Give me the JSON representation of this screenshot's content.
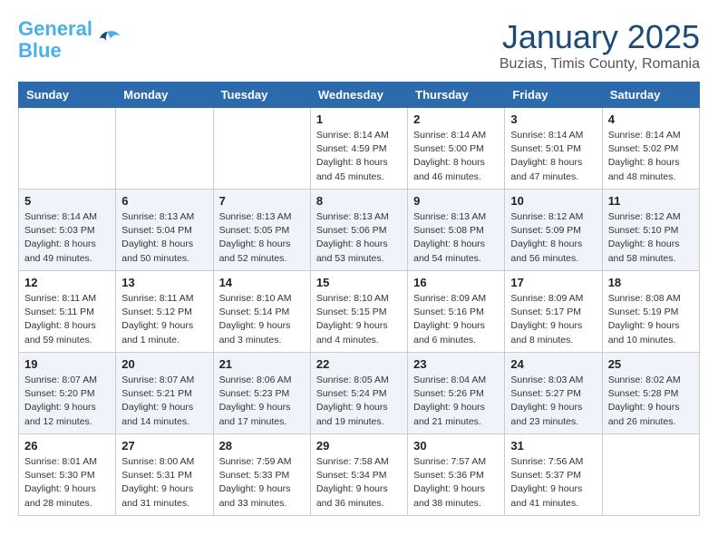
{
  "header": {
    "logo_line1": "General",
    "logo_line2": "Blue",
    "title": "January 2025",
    "subtitle": "Buzias, Timis County, Romania"
  },
  "weekdays": [
    "Sunday",
    "Monday",
    "Tuesday",
    "Wednesday",
    "Thursday",
    "Friday",
    "Saturday"
  ],
  "weeks": [
    [
      {
        "day": "",
        "info": ""
      },
      {
        "day": "",
        "info": ""
      },
      {
        "day": "",
        "info": ""
      },
      {
        "day": "1",
        "info": "Sunrise: 8:14 AM\nSunset: 4:59 PM\nDaylight: 8 hours\nand 45 minutes."
      },
      {
        "day": "2",
        "info": "Sunrise: 8:14 AM\nSunset: 5:00 PM\nDaylight: 8 hours\nand 46 minutes."
      },
      {
        "day": "3",
        "info": "Sunrise: 8:14 AM\nSunset: 5:01 PM\nDaylight: 8 hours\nand 47 minutes."
      },
      {
        "day": "4",
        "info": "Sunrise: 8:14 AM\nSunset: 5:02 PM\nDaylight: 8 hours\nand 48 minutes."
      }
    ],
    [
      {
        "day": "5",
        "info": "Sunrise: 8:14 AM\nSunset: 5:03 PM\nDaylight: 8 hours\nand 49 minutes."
      },
      {
        "day": "6",
        "info": "Sunrise: 8:13 AM\nSunset: 5:04 PM\nDaylight: 8 hours\nand 50 minutes."
      },
      {
        "day": "7",
        "info": "Sunrise: 8:13 AM\nSunset: 5:05 PM\nDaylight: 8 hours\nand 52 minutes."
      },
      {
        "day": "8",
        "info": "Sunrise: 8:13 AM\nSunset: 5:06 PM\nDaylight: 8 hours\nand 53 minutes."
      },
      {
        "day": "9",
        "info": "Sunrise: 8:13 AM\nSunset: 5:08 PM\nDaylight: 8 hours\nand 54 minutes."
      },
      {
        "day": "10",
        "info": "Sunrise: 8:12 AM\nSunset: 5:09 PM\nDaylight: 8 hours\nand 56 minutes."
      },
      {
        "day": "11",
        "info": "Sunrise: 8:12 AM\nSunset: 5:10 PM\nDaylight: 8 hours\nand 58 minutes."
      }
    ],
    [
      {
        "day": "12",
        "info": "Sunrise: 8:11 AM\nSunset: 5:11 PM\nDaylight: 8 hours\nand 59 minutes."
      },
      {
        "day": "13",
        "info": "Sunrise: 8:11 AM\nSunset: 5:12 PM\nDaylight: 9 hours\nand 1 minute."
      },
      {
        "day": "14",
        "info": "Sunrise: 8:10 AM\nSunset: 5:14 PM\nDaylight: 9 hours\nand 3 minutes."
      },
      {
        "day": "15",
        "info": "Sunrise: 8:10 AM\nSunset: 5:15 PM\nDaylight: 9 hours\nand 4 minutes."
      },
      {
        "day": "16",
        "info": "Sunrise: 8:09 AM\nSunset: 5:16 PM\nDaylight: 9 hours\nand 6 minutes."
      },
      {
        "day": "17",
        "info": "Sunrise: 8:09 AM\nSunset: 5:17 PM\nDaylight: 9 hours\nand 8 minutes."
      },
      {
        "day": "18",
        "info": "Sunrise: 8:08 AM\nSunset: 5:19 PM\nDaylight: 9 hours\nand 10 minutes."
      }
    ],
    [
      {
        "day": "19",
        "info": "Sunrise: 8:07 AM\nSunset: 5:20 PM\nDaylight: 9 hours\nand 12 minutes."
      },
      {
        "day": "20",
        "info": "Sunrise: 8:07 AM\nSunset: 5:21 PM\nDaylight: 9 hours\nand 14 minutes."
      },
      {
        "day": "21",
        "info": "Sunrise: 8:06 AM\nSunset: 5:23 PM\nDaylight: 9 hours\nand 17 minutes."
      },
      {
        "day": "22",
        "info": "Sunrise: 8:05 AM\nSunset: 5:24 PM\nDaylight: 9 hours\nand 19 minutes."
      },
      {
        "day": "23",
        "info": "Sunrise: 8:04 AM\nSunset: 5:26 PM\nDaylight: 9 hours\nand 21 minutes."
      },
      {
        "day": "24",
        "info": "Sunrise: 8:03 AM\nSunset: 5:27 PM\nDaylight: 9 hours\nand 23 minutes."
      },
      {
        "day": "25",
        "info": "Sunrise: 8:02 AM\nSunset: 5:28 PM\nDaylight: 9 hours\nand 26 minutes."
      }
    ],
    [
      {
        "day": "26",
        "info": "Sunrise: 8:01 AM\nSunset: 5:30 PM\nDaylight: 9 hours\nand 28 minutes."
      },
      {
        "day": "27",
        "info": "Sunrise: 8:00 AM\nSunset: 5:31 PM\nDaylight: 9 hours\nand 31 minutes."
      },
      {
        "day": "28",
        "info": "Sunrise: 7:59 AM\nSunset: 5:33 PM\nDaylight: 9 hours\nand 33 minutes."
      },
      {
        "day": "29",
        "info": "Sunrise: 7:58 AM\nSunset: 5:34 PM\nDaylight: 9 hours\nand 36 minutes."
      },
      {
        "day": "30",
        "info": "Sunrise: 7:57 AM\nSunset: 5:36 PM\nDaylight: 9 hours\nand 38 minutes."
      },
      {
        "day": "31",
        "info": "Sunrise: 7:56 AM\nSunset: 5:37 PM\nDaylight: 9 hours\nand 41 minutes."
      },
      {
        "day": "",
        "info": ""
      }
    ]
  ]
}
